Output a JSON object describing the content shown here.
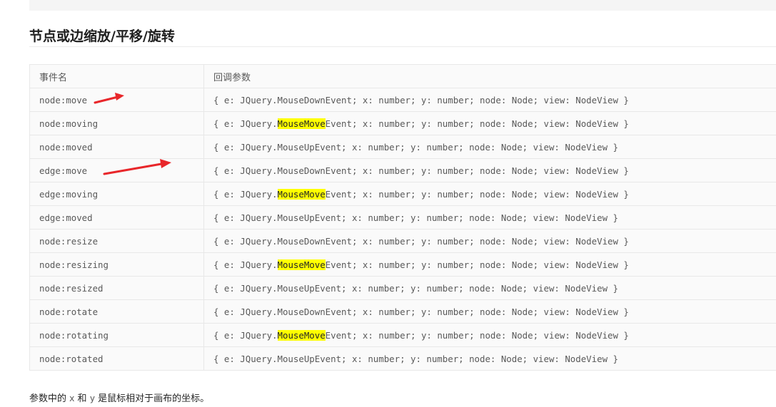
{
  "section_title": "节点或边缩放/平移/旋转",
  "table": {
    "headers": [
      "事件名",
      "回调参数"
    ],
    "rows": [
      {
        "name": "node:move",
        "cb_pre": "{ e: JQuery.MouseDownEvent; x: number; y: number; node: Node; view: NodeView }",
        "cb_hl": "",
        "cb_post": ""
      },
      {
        "name": "node:moving",
        "cb_pre": "{ e: JQuery.",
        "cb_hl": "MouseMove",
        "cb_post": "Event; x: number; y: number; node: Node; view: NodeView }"
      },
      {
        "name": "node:moved",
        "cb_pre": "{ e: JQuery.MouseUpEvent; x: number; y: number; node: Node; view: NodeView }",
        "cb_hl": "",
        "cb_post": ""
      },
      {
        "name": "edge:move",
        "cb_pre": "{ e: JQuery.MouseDownEvent; x: number; y: number; node: Node; view: NodeView }",
        "cb_hl": "",
        "cb_post": ""
      },
      {
        "name": "edge:moving",
        "cb_pre": "{ e: JQuery.",
        "cb_hl": "MouseMove",
        "cb_post": "Event; x: number; y: number; node: Node; view: NodeView }"
      },
      {
        "name": "edge:moved",
        "cb_pre": "{ e: JQuery.MouseUpEvent; x: number; y: number; node: Node; view: NodeView }",
        "cb_hl": "",
        "cb_post": ""
      },
      {
        "name": "node:resize",
        "cb_pre": "{ e: JQuery.MouseDownEvent; x: number; y: number; node: Node; view: NodeView }",
        "cb_hl": "",
        "cb_post": ""
      },
      {
        "name": "node:resizing",
        "cb_pre": "{ e: JQuery.",
        "cb_hl": "MouseMove",
        "cb_post": "Event; x: number; y: number; node: Node; view: NodeView }"
      },
      {
        "name": "node:resized",
        "cb_pre": "{ e: JQuery.MouseUpEvent; x: number; y: number; node: Node; view: NodeView }",
        "cb_hl": "",
        "cb_post": ""
      },
      {
        "name": "node:rotate",
        "cb_pre": "{ e: JQuery.MouseDownEvent; x: number; y: number; node: Node; view: NodeView }",
        "cb_hl": "",
        "cb_post": ""
      },
      {
        "name": "node:rotating",
        "cb_pre": "{ e: JQuery.",
        "cb_hl": "MouseMove",
        "cb_post": "Event; x: number; y: number; node: Node; view: NodeView }"
      },
      {
        "name": "node:rotated",
        "cb_pre": "{ e: JQuery.MouseUpEvent; x: number; y: number; node: Node; view: NodeView }",
        "cb_hl": "",
        "cb_post": ""
      }
    ]
  },
  "note": {
    "text_1": "参数中的",
    "code_x": "x",
    "text_2": "和",
    "code_y": "y",
    "text_3": "是鼠标相对于画布的坐标。"
  },
  "colors": {
    "highlight": "#ffff00",
    "annotation_arrow": "#e8262a"
  },
  "icons": [
    "annotation-arrow-icon",
    "annotation-arrow-icon"
  ]
}
